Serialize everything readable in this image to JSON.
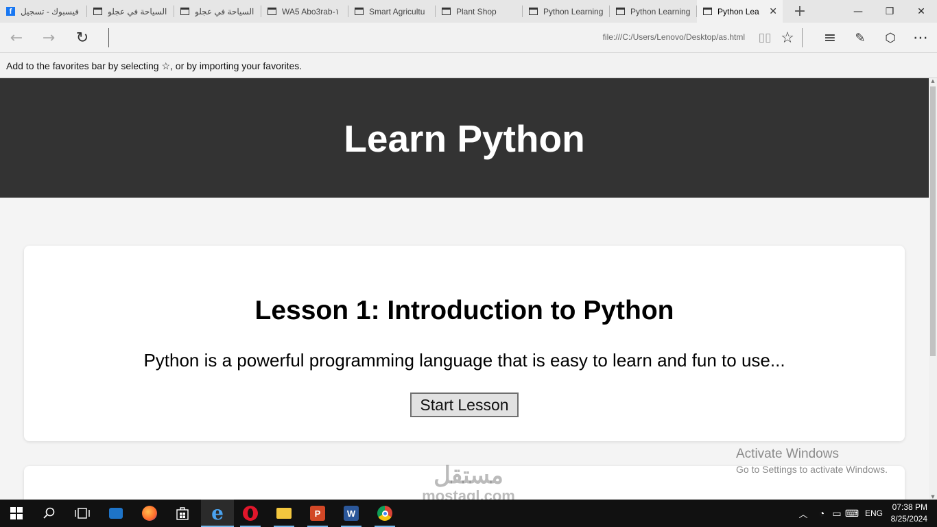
{
  "browser": {
    "tabs": [
      {
        "label": "فيسبوك - تسجيل",
        "icon": "facebook-icon"
      },
      {
        "label": "السياحة في عجلو",
        "icon": "page-icon"
      },
      {
        "label": "السياحة في عجلو",
        "icon": "page-icon"
      },
      {
        "label": "WA5 Abo3rab-١",
        "icon": "page-icon"
      },
      {
        "label": "Smart Agricultu",
        "icon": "page-icon"
      },
      {
        "label": "Plant Shop",
        "icon": "page-icon"
      },
      {
        "label": "Python Learning",
        "icon": "page-icon"
      },
      {
        "label": "Python Learning",
        "icon": "page-icon"
      }
    ],
    "active_tab": {
      "label": "Python Lea",
      "icon": "page-icon"
    },
    "url": "file:///C:/Users/Lenovo/Desktop/as.html",
    "favorites_hint": "Add to the favorites bar by selecting ☆, or by importing your favorites."
  },
  "page": {
    "title": "Learn Python",
    "lessons": [
      {
        "title": "Lesson 1: Introduction to Python",
        "description": "Python is a powerful programming language that is easy to learn and fun to use...",
        "button": "Start Lesson"
      }
    ]
  },
  "overlay": {
    "activate_title": "Activate Windows",
    "activate_sub": "Go to Settings to activate Windows.",
    "watermark_ar": "مستقل",
    "watermark_en": "mostaql.com"
  },
  "taskbar": {
    "language": "ENG",
    "time": "07:38 PM",
    "date": "8/25/2024"
  },
  "colors": {
    "hero_bg": "#333333",
    "page_bg": "#f4f4f4",
    "accent": "#76b9ed"
  }
}
